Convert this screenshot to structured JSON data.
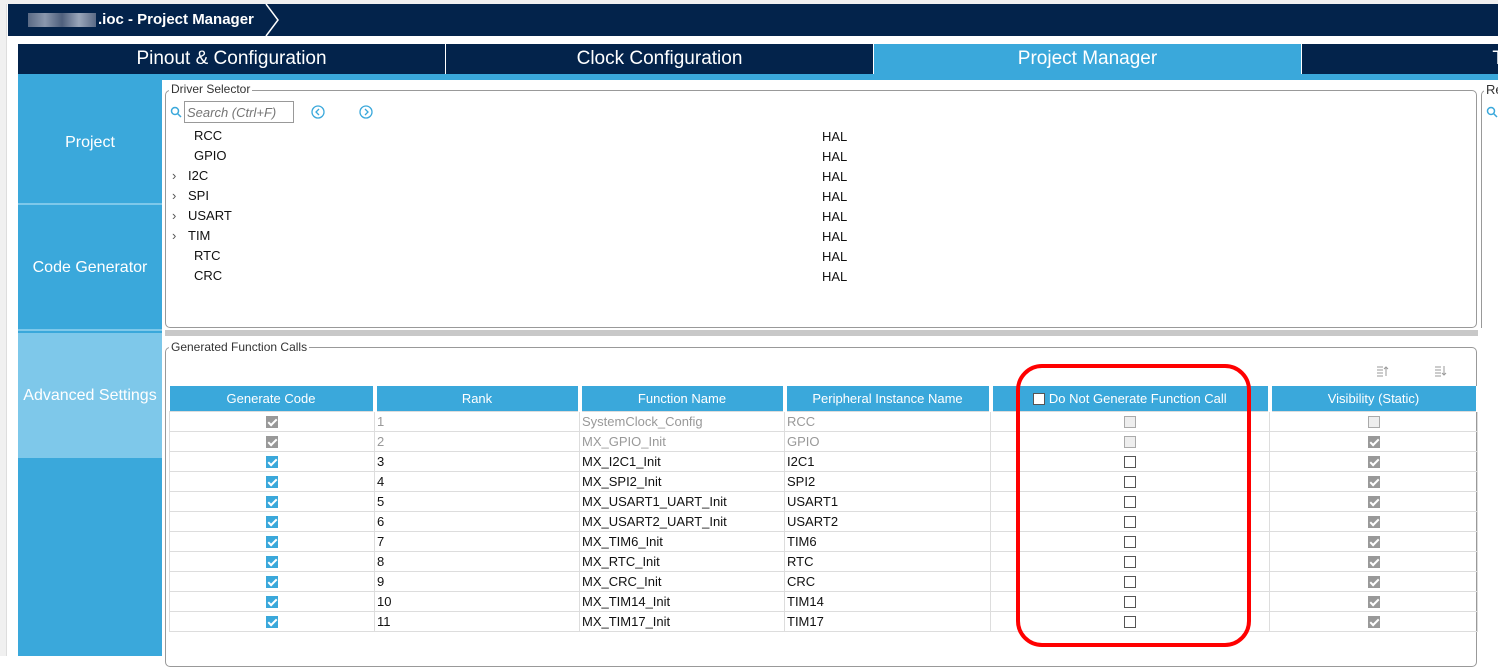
{
  "title": ".ioc - Project Manager",
  "tabs": [
    "Pinout & Configuration",
    "Clock Configuration",
    "Project Manager",
    "T"
  ],
  "sidebar": [
    "Project",
    "Code Generator",
    "Advanced Settings"
  ],
  "driver_selector": {
    "legend": "Driver Selector",
    "search_placeholder": "Search (Ctrl+F)",
    "rows": [
      {
        "name": "RCC",
        "driver": "HAL",
        "expand": false
      },
      {
        "name": "GPIO",
        "driver": "HAL",
        "expand": false
      },
      {
        "name": "I2C",
        "driver": "HAL",
        "expand": true
      },
      {
        "name": "SPI",
        "driver": "HAL",
        "expand": true
      },
      {
        "name": "USART",
        "driver": "HAL",
        "expand": true
      },
      {
        "name": "TIM",
        "driver": "HAL",
        "expand": true
      },
      {
        "name": "RTC",
        "driver": "HAL",
        "expand": false
      },
      {
        "name": "CRC",
        "driver": "HAL",
        "expand": false
      }
    ]
  },
  "right_panel_legend": "Re",
  "function_calls": {
    "legend": "Generated Function Calls",
    "columns": [
      "Generate Code",
      "Rank",
      "Function Name",
      "Peripheral Instance Name",
      "Do Not Generate Function Call",
      "Visibility (Static)"
    ],
    "rows": [
      {
        "generate": true,
        "rank": "1",
        "fn": "SystemClock_Config",
        "periph": "RCC",
        "nogen": false,
        "visible": false,
        "disabled": true
      },
      {
        "generate": true,
        "rank": "2",
        "fn": "MX_GPIO_Init",
        "periph": "GPIO",
        "nogen": false,
        "visible": true,
        "disabled": true
      },
      {
        "generate": true,
        "rank": "3",
        "fn": "MX_I2C1_Init",
        "periph": "I2C1",
        "nogen": false,
        "visible": true,
        "disabled": false
      },
      {
        "generate": true,
        "rank": "4",
        "fn": "MX_SPI2_Init",
        "periph": "SPI2",
        "nogen": false,
        "visible": true,
        "disabled": false
      },
      {
        "generate": true,
        "rank": "5",
        "fn": "MX_USART1_UART_Init",
        "periph": "USART1",
        "nogen": false,
        "visible": true,
        "disabled": false
      },
      {
        "generate": true,
        "rank": "6",
        "fn": "MX_USART2_UART_Init",
        "periph": "USART2",
        "nogen": false,
        "visible": true,
        "disabled": false
      },
      {
        "generate": true,
        "rank": "7",
        "fn": "MX_TIM6_Init",
        "periph": "TIM6",
        "nogen": false,
        "visible": true,
        "disabled": false
      },
      {
        "generate": true,
        "rank": "8",
        "fn": "MX_RTC_Init",
        "periph": "RTC",
        "nogen": false,
        "visible": true,
        "disabled": false
      },
      {
        "generate": true,
        "rank": "9",
        "fn": "MX_CRC_Init",
        "periph": "CRC",
        "nogen": false,
        "visible": true,
        "disabled": false
      },
      {
        "generate": true,
        "rank": "10",
        "fn": "MX_TIM14_Init",
        "periph": "TIM14",
        "nogen": false,
        "visible": true,
        "disabled": false
      },
      {
        "generate": true,
        "rank": "11",
        "fn": "MX_TIM17_Init",
        "periph": "TIM17",
        "nogen": false,
        "visible": true,
        "disabled": false
      }
    ]
  },
  "colors": {
    "navy": "#03234b",
    "blue": "#3aa8db",
    "light_blue": "#7ec8ea",
    "highlight": "#ff0000"
  }
}
